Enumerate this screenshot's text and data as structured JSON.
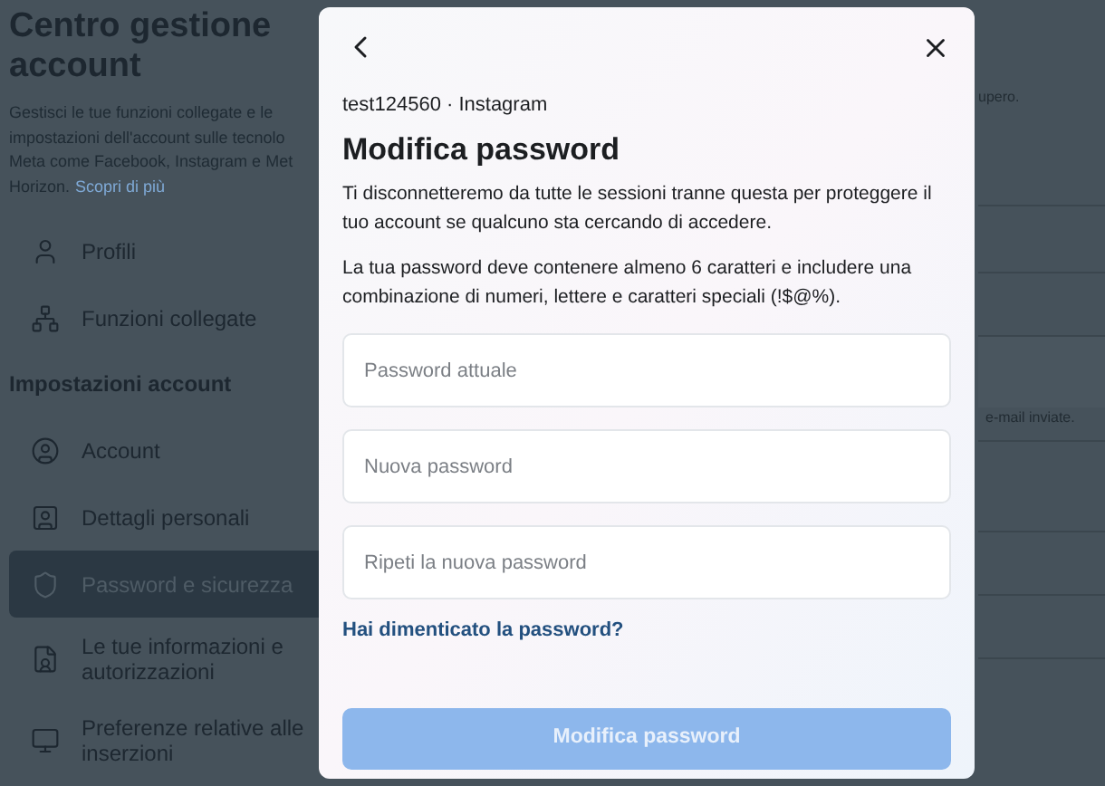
{
  "sidebar": {
    "title": "Centro gestione account",
    "description_lines": [
      "Gestisci le tue funzioni collegate e le",
      "impostazioni dell'account sulle tecnolo",
      "Meta come Facebook, Instagram e Met",
      "Horizon."
    ],
    "learn_more": "Scopri di più",
    "items": [
      {
        "kind": "item",
        "label": "Profili",
        "selected": false
      },
      {
        "kind": "item",
        "label": "Funzioni collegate",
        "selected": false
      },
      {
        "kind": "heading",
        "label": "Impostazioni account"
      },
      {
        "kind": "item",
        "label": "Account",
        "selected": false
      },
      {
        "kind": "item",
        "label": "Dettagli personali",
        "selected": false
      },
      {
        "kind": "item",
        "label": "Password e sicurezza",
        "selected": true
      },
      {
        "kind": "item",
        "label": "Le tue informazioni e autorizzazioni",
        "selected": false
      },
      {
        "kind": "item",
        "label": "Preferenze relative alle inserzioni",
        "selected": false
      }
    ]
  },
  "background_texts": [
    "upero.",
    "e-mail inviate."
  ],
  "dialog": {
    "account": "test124560 · Instagram",
    "title": "Modifica password",
    "paragraphs": [
      "Ti disconnetteremo da tutte le sessioni tranne questa per proteggere il tuo account se qualcuno sta cercando di accedere.",
      "La tua password deve contenere almeno 6 caratteri e includere una combinazione di numeri, lettere e caratteri speciali (!$@%)."
    ],
    "fields": [
      {
        "placeholder": "Password attuale"
      },
      {
        "placeholder": "Nuova password"
      },
      {
        "placeholder": "Ripeti la nuova password"
      }
    ],
    "forgot_link": "Hai dimenticato la password?",
    "submit": {
      "label": "Modifica password",
      "disabled": true
    }
  }
}
